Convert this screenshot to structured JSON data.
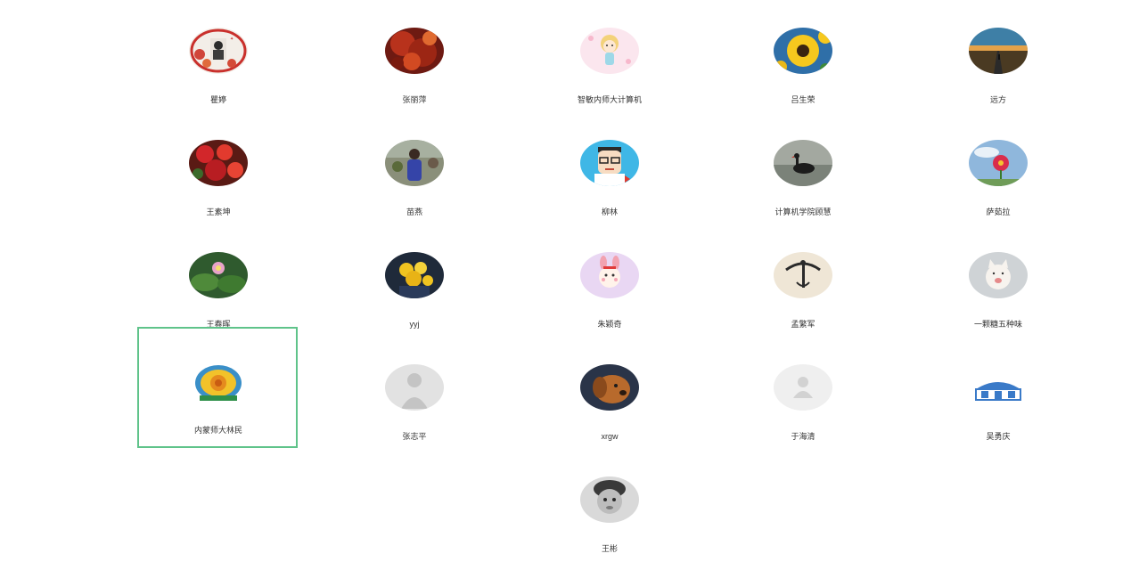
{
  "members": [
    {
      "name": "瞿婷",
      "icon": "certificate-portrait-avatar"
    },
    {
      "name": "张丽萍",
      "icon": "red-flowers-avatar"
    },
    {
      "name": "智敏内师大计算机",
      "icon": "cartoon-girl-avatar"
    },
    {
      "name": "吕生荣",
      "icon": "sunflower-avatar"
    },
    {
      "name": "远方",
      "icon": "road-sunset-avatar"
    },
    {
      "name": "王素坤",
      "icon": "red-blossom-avatar"
    },
    {
      "name": "苗燕",
      "icon": "person-photo-avatar"
    },
    {
      "name": "柳林",
      "icon": "cartoon-glasses-man-avatar"
    },
    {
      "name": "计算机学院顾慧",
      "icon": "black-swan-avatar"
    },
    {
      "name": "萨茹拉",
      "icon": "flower-sky-avatar"
    },
    {
      "name": "王春晖",
      "icon": "lotus-avatar"
    },
    {
      "name": "yyj",
      "icon": "yellow-flowers-avatar"
    },
    {
      "name": "朱颖奇",
      "icon": "cartoon-bunny-avatar"
    },
    {
      "name": "孟繁军",
      "icon": "bird-totem-avatar"
    },
    {
      "name": "一颗糖五种味",
      "icon": "cat-avatar"
    },
    {
      "name": "内蒙师大林民",
      "icon": "university-emblem-avatar"
    },
    {
      "name": "张志平",
      "icon": "default-user-avatar"
    },
    {
      "name": "xrgw",
      "icon": "dog-avatar"
    },
    {
      "name": "于海清",
      "icon": "default-user-avatar"
    },
    {
      "name": "吴勇庆",
      "icon": "yurt-logo-avatar"
    },
    {
      "name": "王彬",
      "icon": "child-portrait-avatar"
    }
  ],
  "selected_member": "内蒙师大林民",
  "colors": {
    "selection_border": "#5fc38a",
    "name_text": "#333333",
    "background": "#ffffff"
  }
}
